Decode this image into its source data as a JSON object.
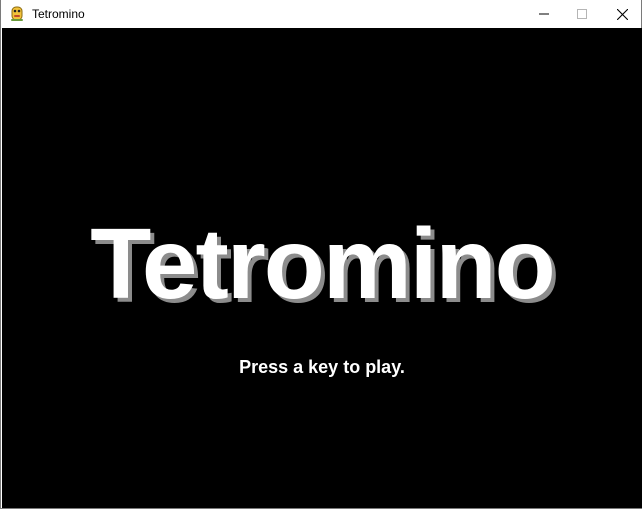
{
  "window": {
    "title": "Tetromino",
    "icon": "python-snake-icon",
    "controls": [
      "minimize-icon",
      "maximize-icon",
      "close-icon"
    ]
  },
  "screen": {
    "background": "#000000",
    "title_text": "Tetromino",
    "title_color": "#ffffff",
    "title_shadow_color": "#8c8c8c",
    "prompt_text": "Press a key to play."
  }
}
